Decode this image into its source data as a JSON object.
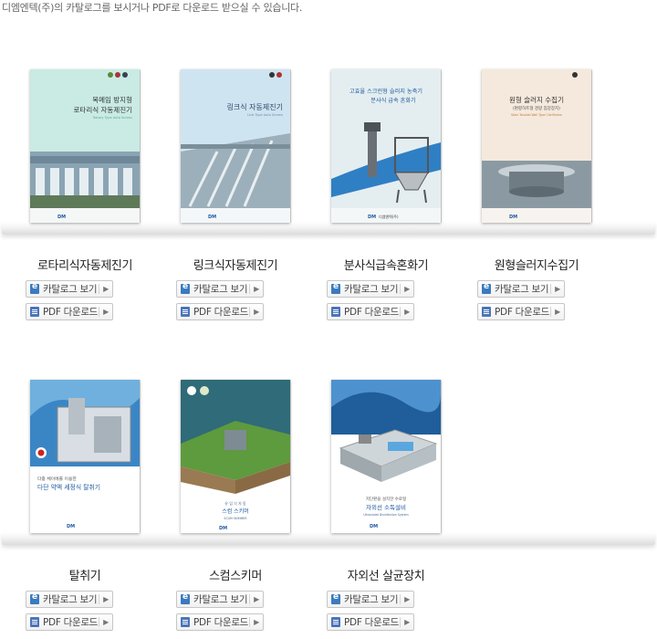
{
  "intro": "디엠엔텍(주)의 카탈로그를 보시거나 PDF로 다운로드 받으실 수 있습니다.",
  "buttons": {
    "catalog": "카탈로그 보기",
    "pdf": "PDF 다운로드"
  },
  "products": [
    {
      "name": "로타리식자동제진기",
      "cover_title": [
        "목메임 방지형",
        "로타리식 자동제진기"
      ],
      "cover_sub": "Rotary Type Auto Screen"
    },
    {
      "name": "링크식자동제진기",
      "cover_title": [
        "링크식 자동제진기"
      ],
      "cover_sub": "Link Type Auto Screen"
    },
    {
      "name": "분사식급속혼화기",
      "cover_title": [
        "고효율 스크린형 슬러지 농축기",
        "분사식 급속 혼화기"
      ],
      "cover_sub": ""
    },
    {
      "name": "원형슬러지수집기",
      "cover_title": [
        "원형 슬러지 수집기",
        "(편향하트형 경량 침강장치)"
      ],
      "cover_sub": "Stain Toroidal Wall Type Clarificator"
    },
    {
      "name": "탈취기",
      "cover_title": [
        "다중 체이에를 이용한",
        "다단 약액 세정식 탈취기"
      ],
      "cover_sub": ""
    },
    {
      "name": "스컴스키머",
      "cover_title": [
        "유 입 식 자 동",
        "스컴 스키머"
      ],
      "cover_sub": "SCUM SKIMMER"
    },
    {
      "name": "자외선 살균장치",
      "cover_title": [
        "저단판을 설치한 수로형",
        "자외선 소독설비"
      ],
      "cover_sub": "Ultraviolet Disinfection System"
    }
  ],
  "cover_brand": "디엠엔텍(주)",
  "colors": {
    "accent_blue": "#1e6eb5",
    "cover_green": "#d8eee7",
    "cover_sky": "#cfe6f2"
  }
}
